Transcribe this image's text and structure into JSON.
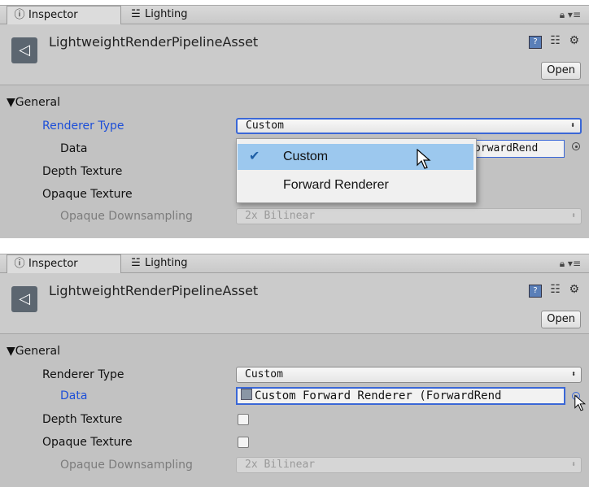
{
  "panels": [
    {
      "tabs": {
        "inspector": "Inspector",
        "lighting": "Lighting"
      },
      "asset_name": "LightweightRenderPipelineAsset",
      "open_label": "Open",
      "section": "General",
      "rows": {
        "renderer_type": {
          "label": "Renderer Type",
          "value": "Custom"
        },
        "data": {
          "label": "Data",
          "value": "orwardRend"
        },
        "depth_texture": {
          "label": "Depth Texture"
        },
        "opaque_texture": {
          "label": "Opaque Texture"
        },
        "opaque_downsampling": {
          "label": "Opaque Downsampling",
          "value": "2x Bilinear"
        }
      },
      "dropdown": {
        "options": [
          "Custom",
          "Forward Renderer"
        ],
        "selected": "Custom"
      }
    },
    {
      "tabs": {
        "inspector": "Inspector",
        "lighting": "Lighting"
      },
      "asset_name": "LightweightRenderPipelineAsset",
      "open_label": "Open",
      "section": "General",
      "rows": {
        "renderer_type": {
          "label": "Renderer Type",
          "value": "Custom"
        },
        "data": {
          "label": "Data",
          "value": "Custom Forward Renderer (ForwardRend"
        },
        "depth_texture": {
          "label": "Depth Texture"
        },
        "opaque_texture": {
          "label": "Opaque Texture"
        },
        "opaque_downsampling": {
          "label": "Opaque Downsampling",
          "value": "2x Bilinear"
        }
      }
    }
  ],
  "icons": [
    "info-icon",
    "lighting-icon",
    "lock-icon",
    "menu-icon",
    "unity-asset-icon",
    "help-book-icon",
    "preset-icon",
    "gear-icon",
    "object-picker-icon",
    "checkmark-icon",
    "mouse-cursor-icon"
  ],
  "colors": {
    "panel_bg": "#c2c2c2",
    "highlight_blue": "#1d4fd8",
    "focus_border": "#3a67d6",
    "selection_bg": "#9cc8ee"
  }
}
